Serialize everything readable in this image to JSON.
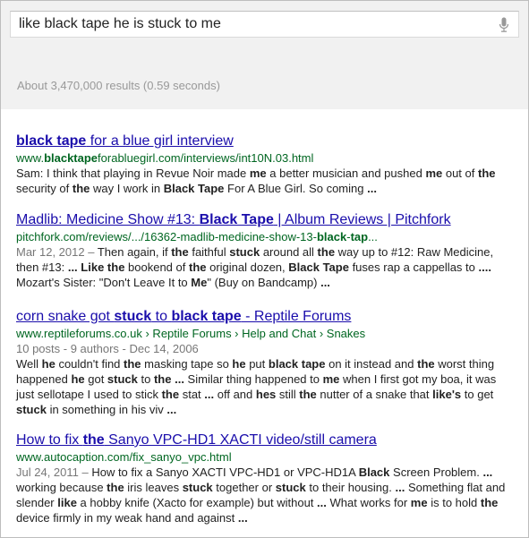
{
  "search": {
    "query": "like black tape he is stuck to me",
    "voice_icon": "microphone-icon"
  },
  "stats": "About 3,470,000 results (0.59 seconds)",
  "colors": {
    "link": "#1a0dab",
    "url": "#006621",
    "snippet": "#222222",
    "meta": "#777777",
    "header_bg": "#f1f1f1"
  },
  "results": [
    {
      "title_html": "<b>black tape</b> for a blue girl interview",
      "url_html": "www.<b>blacktape</b>forabluegirl.com/interviews/int10N.03.html",
      "snippet_html": "Sam: I think that playing in Revue Noir made <b>me</b> a better musician and pushed <b>me</b> out of <b>the</b> security of <b>the</b> way I work in <b>Black Tape</b> For A Blue Girl. So coming <b>...</b>"
    },
    {
      "title_html": "Madlib: Medicine Show #13: <b>Black Tape</b> | Album Reviews | Pitchfork",
      "url_html": "pitchfork.com/reviews/.../16362-madlib-medicine-show-13-<b>black</b>-<b>tap</b>...",
      "snippet_html": "<span class=\"meta\">Mar 12, 2012 – </span>Then again, if <b>the</b> faithful <b>stuck</b> around all <b>the</b> way up to #12: Raw Medicine, then #13: <b>...</b> <b>Like the</b> bookend of <b>the</b> original dozen, <b>Black Tape</b> fuses rap a cappellas to <b>....</b> Mozart's Sister: \"Don't Leave It to <b>Me</b>\" (Buy on Bandcamp) <b>...</b>"
    },
    {
      "title_html": "corn snake got <b>stuck</b> to <b>black tape</b> - Reptile Forums",
      "url_html": "www.reptileforums.co.uk › Reptile Forums › Help and Chat › Snakes",
      "meta": "10 posts - 9 authors - Dec 14, 2006",
      "snippet_html": "Well <b>he</b> couldn't find <b>the</b> masking tape so <b>he</b> put <b>black tape</b> on it instead and <b>the</b> worst thing happened <b>he</b> got <b>stuck</b> to <b>the</b> <b>...</b> Similar thing happened to <b>me</b> when I first got my boa, it was just sellotape I used to stick <b>the</b> stat <b>...</b> off and <b>hes</b> still <b>the</b> nutter of a snake that <b>like's</b> to get <b>stuck</b> in something in his viv <b>...</b>"
    },
    {
      "title_html": "How to fix <b>the</b> Sanyo VPC-HD1 XACTI video/still camera",
      "url_html": "www.autocaption.com/fix_sanyo_vpc.html",
      "snippet_html": "<span class=\"meta\">Jul 24, 2011 – </span>How to fix a Sanyo XACTI VPC-HD1 or VPC-HD1A <b>Black</b> Screen Problem. <b>...</b> working because <b>the</b> iris leaves <b>stuck</b> together or <b>stuck</b> to their housing. <b>...</b> Something flat and slender <b>like</b> a hobby knife (Xacto for example) but without <b>...</b> What works for <b>me</b> is to hold <b>the</b> device firmly in my weak hand and against <b>...</b>"
    }
  ]
}
